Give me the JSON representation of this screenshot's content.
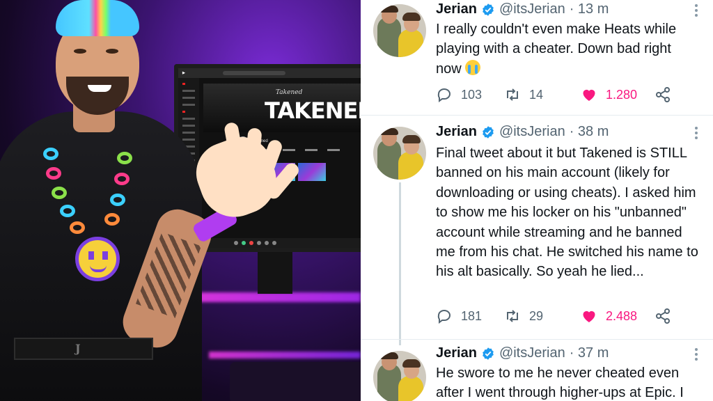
{
  "artwork": {
    "monitor_banner_script": "Takened",
    "monitor_banner_title": "TAKENED",
    "monitor_channel_name": "Takened",
    "belt_text": "J"
  },
  "feed": {
    "accent_like_color": "#f91880",
    "verified_color": "#1d9bf0",
    "tweets": [
      {
        "name": "Jerian",
        "handle": "@itsJerian",
        "time": "· 13 m",
        "text": "I really couldn't even make Heats while playing with a cheater. Down bad right now",
        "emoji": "loudly-crying-face",
        "replies": "103",
        "retweets": "14",
        "likes": "1.280"
      },
      {
        "name": "Jerian",
        "handle": "@itsJerian",
        "time": "· 38 m",
        "text": "Final tweet about it but Takened is STILL banned on his main account (likely for downloading or using cheats). I asked him to show me his locker on his \"unbanned\" account while streaming and he banned me from his chat. He switched his name to his alt basically. So yeah he lied...",
        "replies": "181",
        "retweets": "29",
        "likes": "2.488"
      },
      {
        "name": "Jerian",
        "handle": "@itsJerian",
        "time": "· 37 m",
        "text": "He swore to me he never cheated even after I went through higher-ups at Epic. I"
      }
    ]
  }
}
